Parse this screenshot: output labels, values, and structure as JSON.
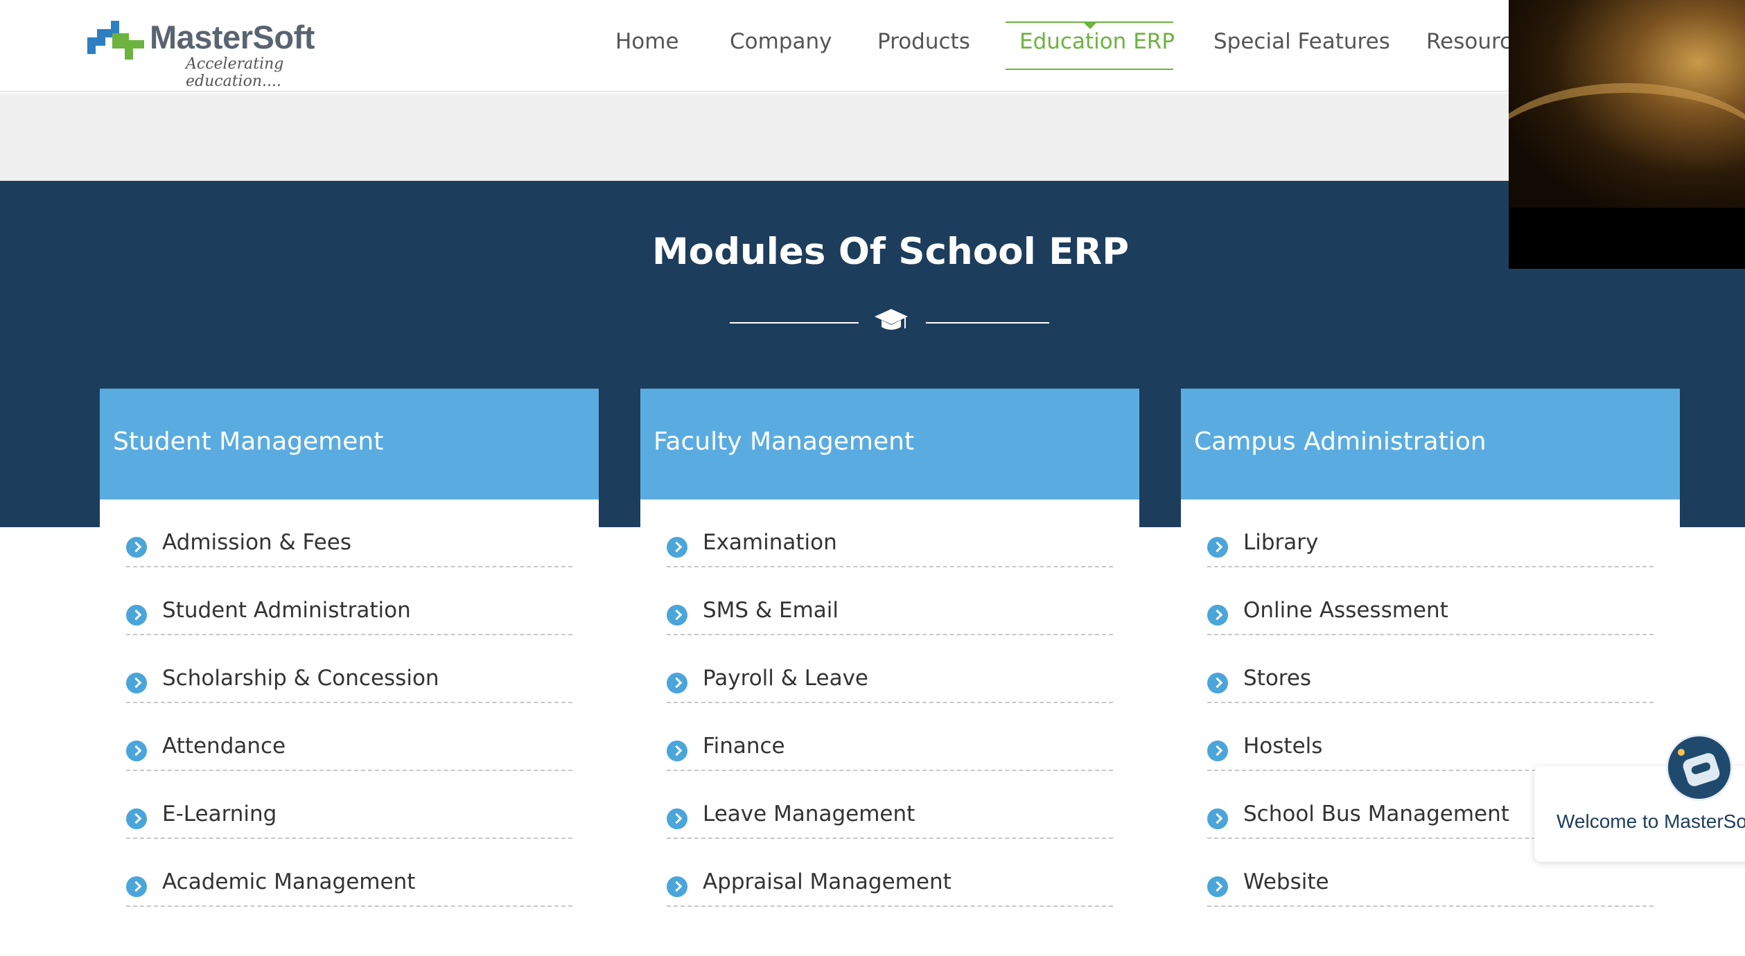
{
  "brand": {
    "name": "MasterSoft",
    "tagline": "Accelerating education....",
    "colors": {
      "green": "#6cb33f",
      "blue": "#2e7fc1",
      "navy": "#1d3d5c",
      "card_header": "#5aace0"
    }
  },
  "nav": {
    "items": [
      {
        "label": "Home",
        "active": false
      },
      {
        "label": "Company",
        "active": false
      },
      {
        "label": "Products",
        "active": false
      },
      {
        "label": "Education ERP",
        "active": true
      },
      {
        "label": "Special Features",
        "active": false
      },
      {
        "label": "Resource",
        "active": false
      }
    ]
  },
  "section": {
    "title": "Modules Of School ERP",
    "icon": "graduation-cap-icon"
  },
  "cards": [
    {
      "title": "Student Management",
      "items": [
        "Admission & Fees",
        "Student Administration",
        "Scholarship & Concession",
        "Attendance",
        "E-Learning",
        "Academic Management"
      ]
    },
    {
      "title": "Faculty Management",
      "items": [
        "Examination",
        "SMS & Email",
        "Payroll & Leave",
        "Finance",
        "Leave Management",
        "Appraisal Management"
      ]
    },
    {
      "title": "Campus Administration",
      "items": [
        "Library",
        "Online Assessment",
        "Stores",
        "Hostels",
        "School Bus Management",
        "Website"
      ]
    }
  ],
  "chat": {
    "message": "Welcome to MasterSo",
    "avatar_icon": "chatbot-icon"
  },
  "video": {
    "icon": "video-thumbnail"
  }
}
